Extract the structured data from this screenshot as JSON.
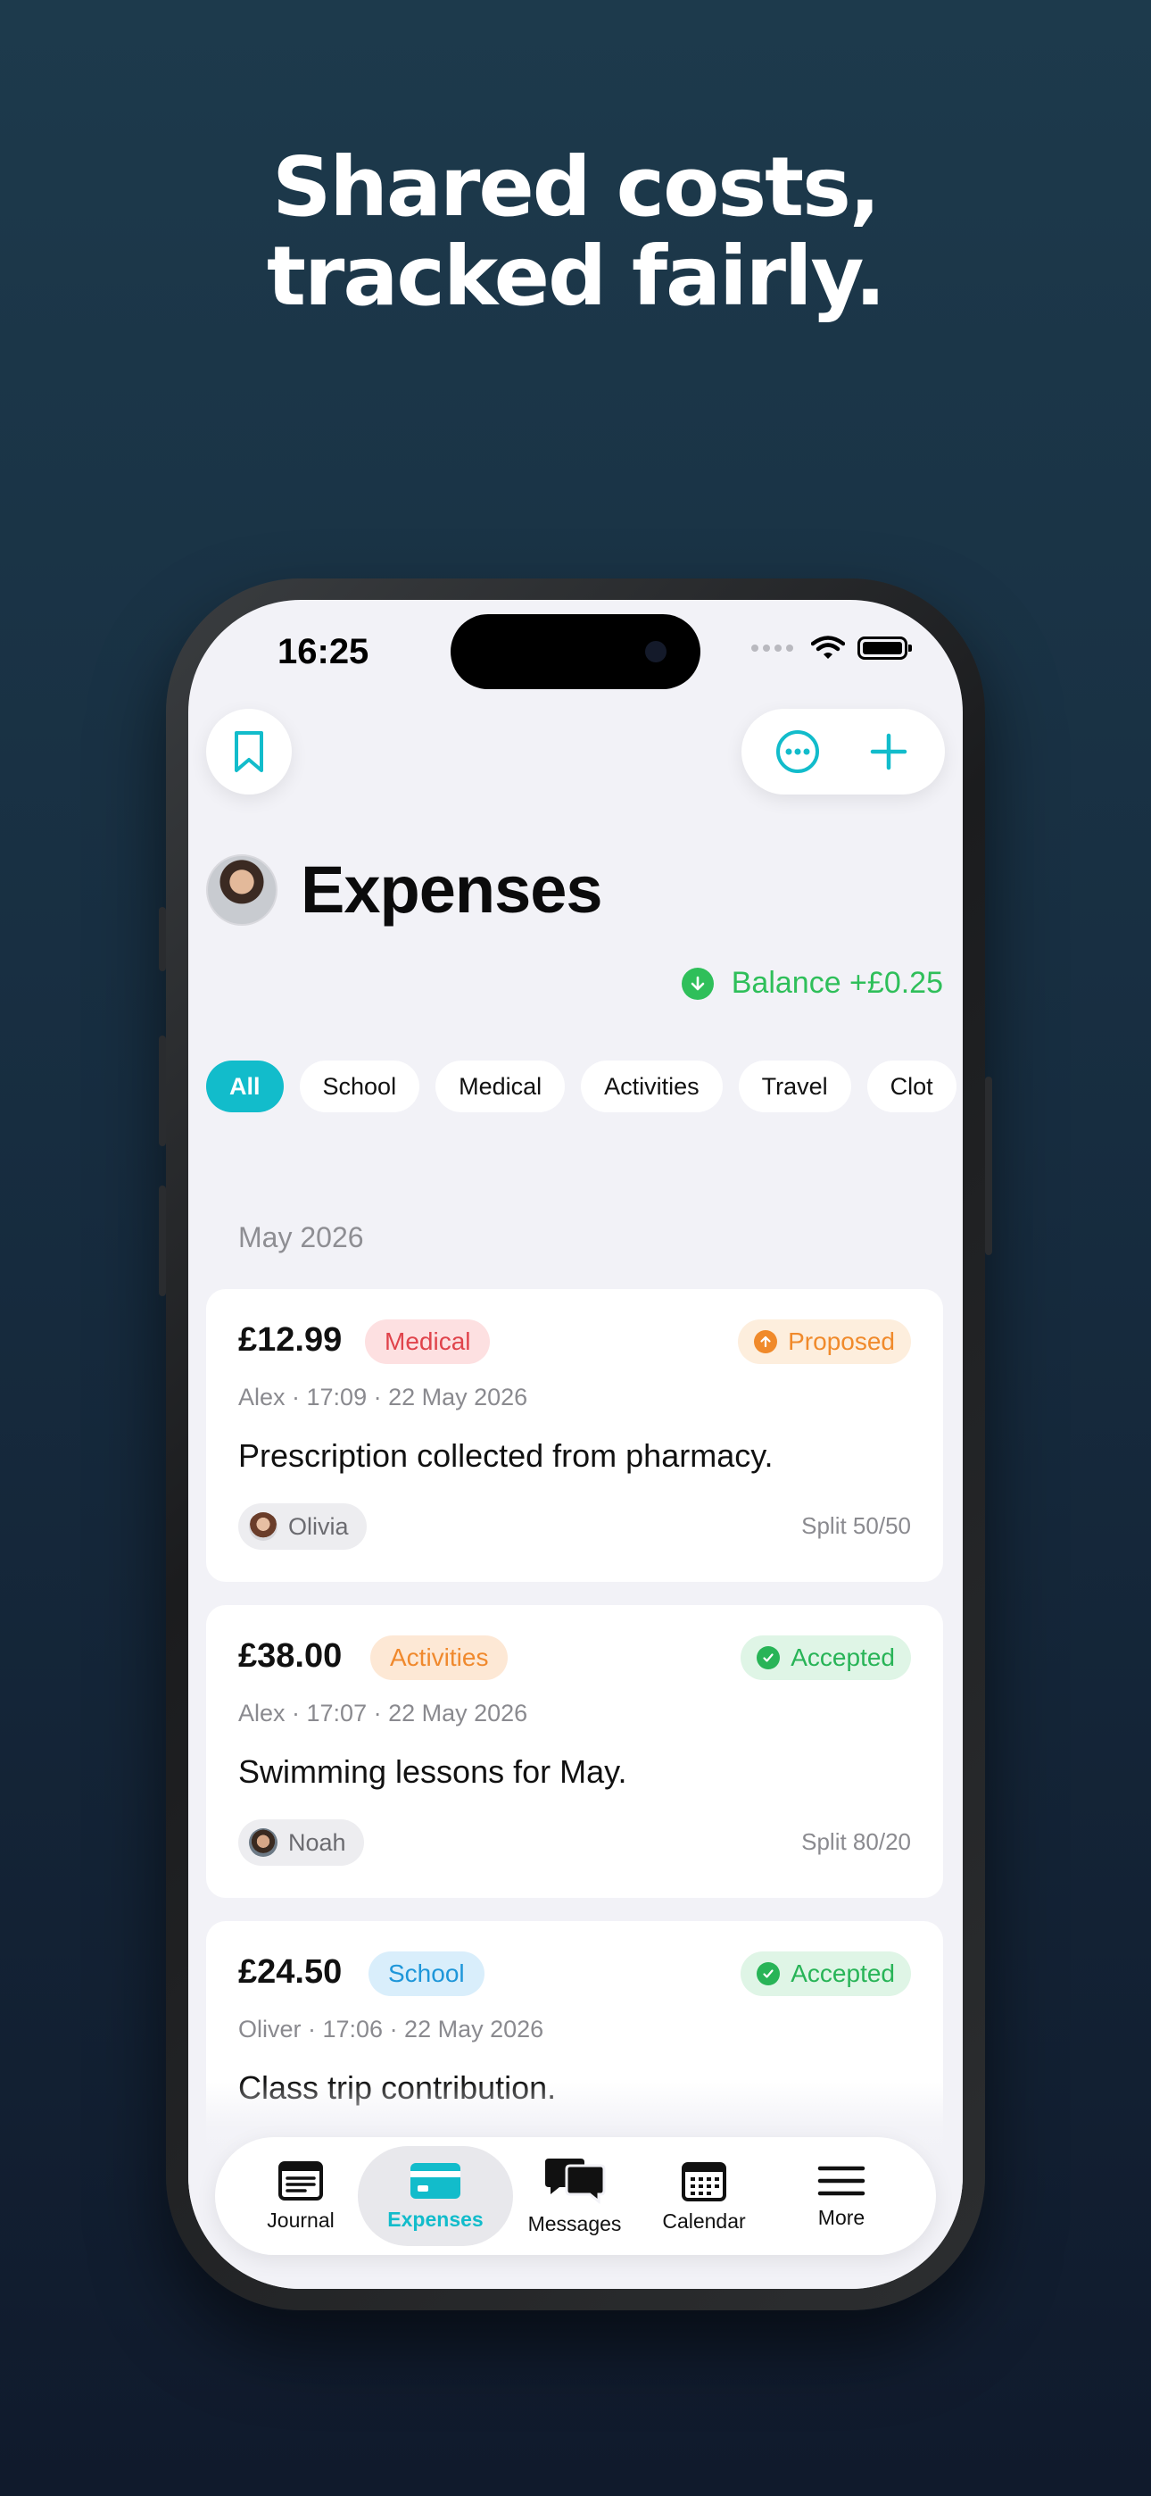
{
  "headline": {
    "line1": "Shared costs,",
    "line2": "tracked fairly."
  },
  "status_bar": {
    "time": "16:25"
  },
  "header": {
    "title": "Expenses"
  },
  "balance": {
    "label": "Balance +£0.25",
    "color": "#2fbf5a"
  },
  "filters": [
    "All",
    "School",
    "Medical",
    "Activities",
    "Travel",
    "Clot"
  ],
  "section": {
    "month": "May 2026"
  },
  "expenses": [
    {
      "amount": "£12.99",
      "category": "Medical",
      "status": "Proposed",
      "meta": "Alex · 17:09 · 22 May 2026",
      "description": "Prescription collected from pharmacy.",
      "person": "Olivia",
      "split": "Split 50/50"
    },
    {
      "amount": "£38.00",
      "category": "Activities",
      "status": "Accepted",
      "meta": "Alex · 17:07 · 22 May 2026",
      "description": "Swimming lessons for May.",
      "person": "Noah",
      "split": "Split 80/20"
    },
    {
      "amount": "£24.50",
      "category": "School",
      "status": "Accepted",
      "meta": "Oliver · 17:06 · 22 May 2026",
      "description": "Class trip contribution.",
      "person": "",
      "split": ""
    }
  ],
  "tabbar": {
    "journal": "Journal",
    "expenses": "Expenses",
    "messages": "Messages",
    "calendar": "Calendar",
    "more": "More"
  },
  "colors": {
    "accent": "#12bccb",
    "background": "#f2f2f7"
  },
  "icons": {
    "top_left": "bookmark-icon",
    "top_right_1": "more-options-icon",
    "top_right_2": "plus-icon",
    "balance": "arrow-down-circle-icon"
  }
}
